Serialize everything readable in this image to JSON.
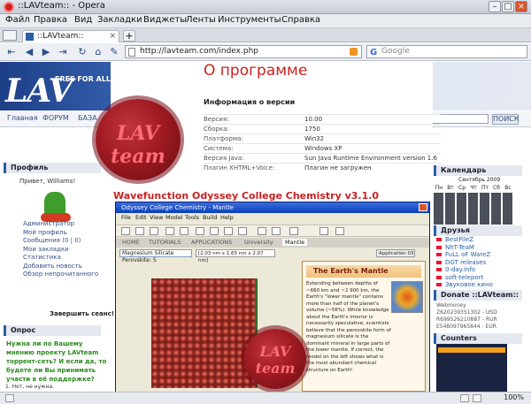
{
  "window": {
    "title": "::LAVteam:: - Opera"
  },
  "menu": [
    "Файл",
    "Правка",
    "Вид",
    "Закладки",
    "Виджеты",
    "Ленты",
    "Инструменты",
    "Справка"
  ],
  "tab": {
    "label": "::LAVteam::"
  },
  "address": {
    "url": "http://lavteam.com/index.php",
    "search_placeholder": "Google"
  },
  "site": {
    "logo": "LAV",
    "logo_sub": "FREE FOR ALL TEAM",
    "nav": [
      "Главная",
      "ФОРУМ",
      "БАЗА"
    ],
    "search_button": "ПОИСК"
  },
  "profile": {
    "header": "Профиль",
    "greeting": "Привет, Williams!",
    "links": [
      "Администратор",
      "Мой профиль",
      "Сообщения (0 | 0)",
      "Мои закладки",
      "Статистика",
      "Добавить новость",
      "Обзор непрочитанного"
    ],
    "exit": "Завершить сеанс!"
  },
  "poll": {
    "header": "Опрос",
    "question": "Нужна ли по Вашему мнению проекту LAVteam торрент-сеть? И если да, то будете ли Вы принимать участи в её поддержке?",
    "option1": "1. Нет, не нужна."
  },
  "about": {
    "title": "О программе",
    "section": "Информация о версии",
    "rows": [
      {
        "k": "Версия:",
        "v": "10.00"
      },
      {
        "k": "Сборка:",
        "v": "1750"
      },
      {
        "k": "Платформа:",
        "v": "Win32"
      },
      {
        "k": "Система:",
        "v": "Windows XP"
      },
      {
        "k": "Версия Java:",
        "v": "Sun Java Runtime Environment version 1.6"
      },
      {
        "k": "Плагин XHTML+Voice:",
        "v": "Плагин не загружен"
      }
    ]
  },
  "post": {
    "title": "Wavefunction Odyssey College Chemistry v3.1.0"
  },
  "app": {
    "title": "Odyssey College Chemistry - Mantle",
    "menu": [
      "File",
      "Edit",
      "View",
      "Model",
      "Tools",
      "Build",
      "Help"
    ],
    "tabs": [
      "HOME",
      "TUTORIALS",
      "APPLICATIONS",
      "University",
      "Mantle"
    ],
    "select": "Magnesium Silicate Perovskite: S",
    "dims": "[2,03 nm x 1,65 nm x 2,07 nm]",
    "app_label": "Application 03",
    "mantle_title": "The Earth's Mantle",
    "mantle_text": "Extending between depths of ~660 km and ~2 900 km, the Earth's \"lower mantle\" contains more than half of the planet's volume (~56%). While knowledge about the Earth's interior is necessarily speculative, scientists believe that the perovskite form of magnesium silicate is the dominant mineral in large parts of the lower mantle. If correct, the model on the left shows what is the most abundant chemical structure on Earth!"
  },
  "calendar": {
    "header": "Календарь",
    "month": "Сентябрь 2009",
    "days": [
      "Пн",
      "Вт",
      "Ср",
      "Чт",
      "Пт",
      "Сб",
      "Вс"
    ]
  },
  "friends": {
    "header": "Друзья",
    "items": [
      "BestFileZ",
      "NhT-TeaM",
      "FuLL oF WareZ",
      "DGT releases",
      "0-day.info",
      "soft-teleport",
      "Звуковое кино"
    ]
  },
  "donate": {
    "header": "Donate ::LAVteam::",
    "label": "Webmoney",
    "wallets": [
      "Z620239351302 - USD",
      "R699526210887 - RUR",
      "E548097965844 - EUR"
    ]
  },
  "counters": {
    "header": "Counters"
  },
  "status": {
    "zoom": "100%"
  },
  "seals": {
    "text": "LAV team"
  }
}
